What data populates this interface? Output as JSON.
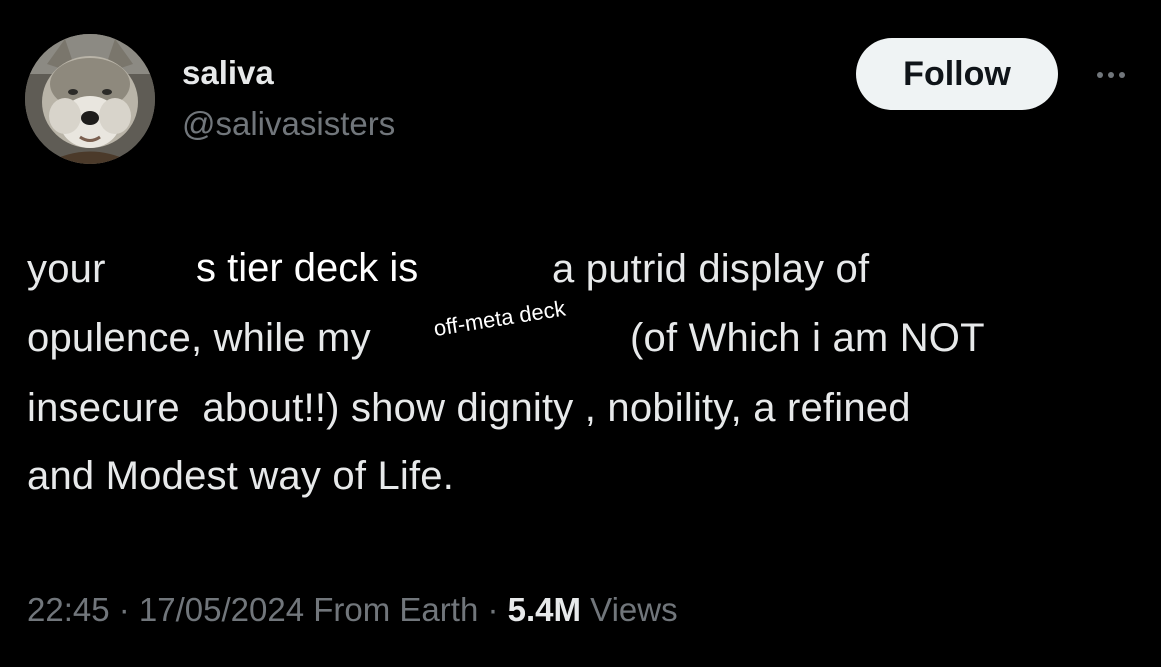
{
  "author": {
    "display_name": "saliva",
    "handle": "@salivasisters"
  },
  "actions": {
    "follow_label": "Follow",
    "more_icon": "more-horizontal-icon"
  },
  "tweet": {
    "line1_left": "your",
    "line1_right": "a putrid display of",
    "line2_left": "opulence, while my",
    "line2_right": "(of Which i am NOT",
    "line3": "insecure  about!!) show dignity , nobility, a refined",
    "line4": "and Modest way of Life.",
    "overlay_tier": "s tier deck is",
    "overlay_offmeta": "off-meta deck"
  },
  "meta": {
    "time": "22:45",
    "sep1": " · ",
    "date": "17/05/2024",
    "location": " From Earth",
    "sep2": " · ",
    "views_count": "5.4M",
    "views_label": " Views"
  },
  "colors": {
    "background": "#000000",
    "text_primary": "#e7e9ea",
    "text_secondary": "#71767b",
    "follow_bg": "#eff3f4"
  }
}
